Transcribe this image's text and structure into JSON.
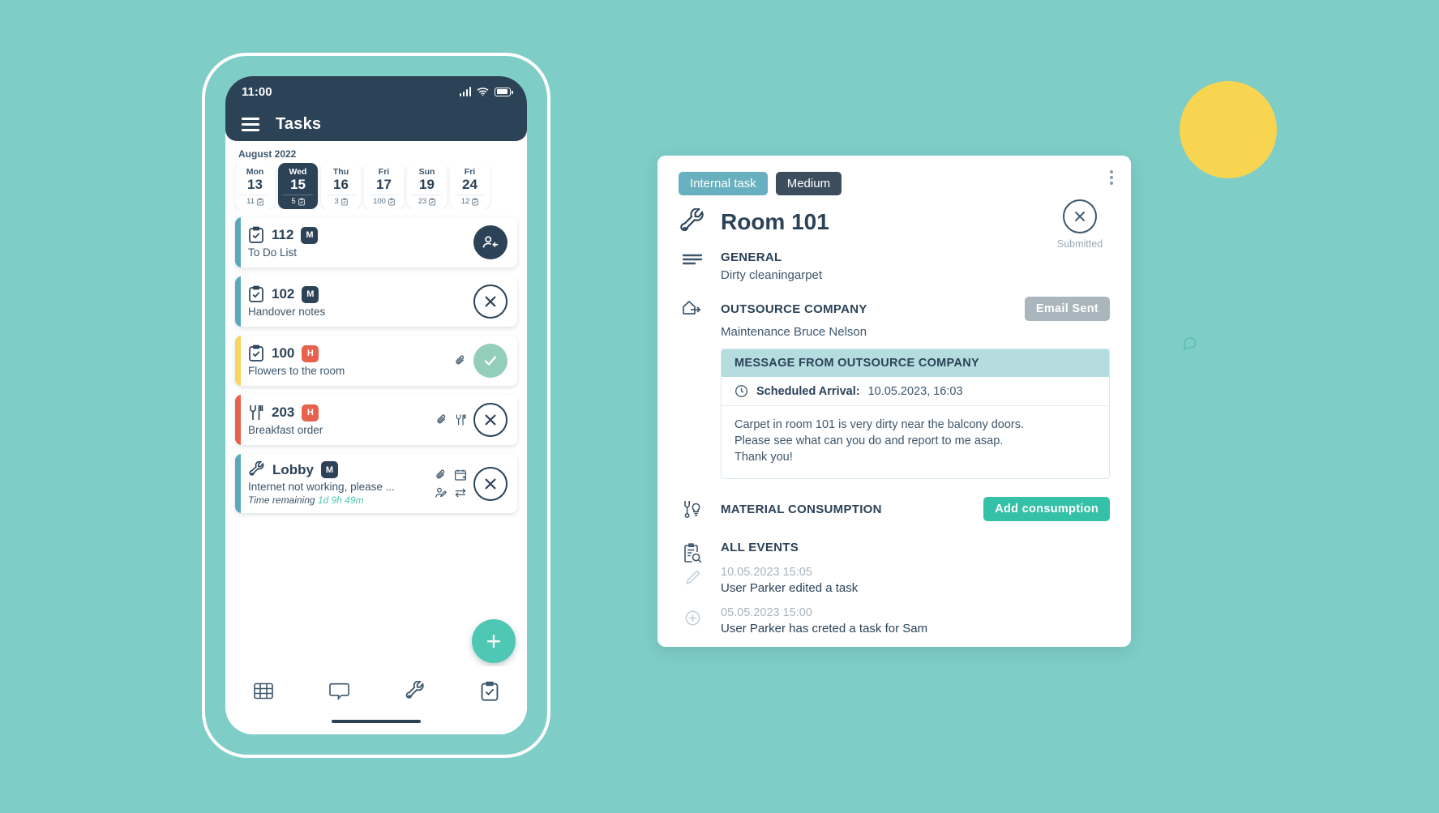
{
  "theme": {
    "background": "#7ecdc6",
    "dark": "#2b4257",
    "teal_accent": "#4ec8b4",
    "yellow": "#f8d550",
    "red": "#e8614d"
  },
  "phone": {
    "status_bar": {
      "time": "11:00",
      "signal_icon": "signal-bars-icon",
      "wifi_icon": "wifi-icon",
      "battery_icon": "battery-icon"
    },
    "app_bar": {
      "menu_icon": "hamburger-menu-icon",
      "title": "Tasks"
    },
    "calendar": {
      "month": "August 2022",
      "days": [
        {
          "dow": "Mon",
          "date": "13",
          "count": "11",
          "active": false
        },
        {
          "dow": "Wed",
          "date": "15",
          "count": "5",
          "active": true
        },
        {
          "dow": "Thu",
          "date": "16",
          "count": "3",
          "active": false
        },
        {
          "dow": "Fri",
          "date": "17",
          "count": "100",
          "active": false
        },
        {
          "dow": "Sun",
          "date": "19",
          "count": "23",
          "active": false
        },
        {
          "dow": "Fri",
          "date": "24",
          "count": "12",
          "active": false
        }
      ]
    },
    "tasks": [
      {
        "id": "112",
        "priority": "M",
        "priority_class": "prio-m",
        "bar": "bar-teal",
        "icon": "clipboard-check-icon",
        "desc": "To Do List",
        "time_label": "",
        "time_value": "",
        "meta_icons": [],
        "action": "assign-user",
        "action_class": "act-dark"
      },
      {
        "id": "102",
        "priority": "M",
        "priority_class": "prio-m",
        "bar": "bar-teal",
        "icon": "clipboard-check-icon",
        "desc": "Handover notes",
        "time_label": "",
        "time_value": "",
        "meta_icons": [],
        "action": "close",
        "action_class": "act-outline"
      },
      {
        "id": "100",
        "priority": "H",
        "priority_class": "prio-h",
        "bar": "bar-yellow",
        "icon": "clipboard-check-icon",
        "desc": "Flowers to the room",
        "time_label": "",
        "time_value": "",
        "meta_icons": [
          "attachment-icon"
        ],
        "action": "check",
        "action_class": "act-green"
      },
      {
        "id": "203",
        "priority": "H",
        "priority_class": "prio-h",
        "bar": "bar-red",
        "icon": "cutlery-icon",
        "desc": "Breakfast order",
        "time_label": "",
        "time_value": "",
        "meta_icons": [
          "attachment-icon",
          "cutlery-icon"
        ],
        "action": "close",
        "action_class": "act-outline"
      },
      {
        "id": "Lobby",
        "priority": "M",
        "priority_class": "prio-m",
        "bar": "bar-teal",
        "icon": "wrench-icon",
        "desc": "Internet not working, please ...",
        "time_label": "Time remaining",
        "time_value": "1d 9h 49m",
        "meta_icons": [
          "attachment-icon",
          "calendar-add-icon",
          "user-edit-icon",
          "transfer-icon"
        ],
        "action": "close",
        "action_class": "act-outline"
      }
    ],
    "fab": {
      "icon": "plus-icon",
      "label": "+"
    },
    "bottom_nav": [
      {
        "icon": "grid-icon",
        "name": "nav-dashboard"
      },
      {
        "icon": "chat-icon",
        "name": "nav-messages"
      },
      {
        "icon": "wrench-icon",
        "name": "nav-maintenance"
      },
      {
        "icon": "clipboard-icon",
        "name": "nav-tasks"
      }
    ]
  },
  "detail": {
    "chips": {
      "type": "Internal task",
      "priority": "Medium"
    },
    "kebab_icon": "more-vertical-icon",
    "title": "Room 101",
    "title_icon": "wrench-icon",
    "status": {
      "icon": "close-circle-icon",
      "label": "Submitted"
    },
    "general": {
      "icon": "lines-icon",
      "heading": "GENERAL",
      "text": "Dirty cleaningarpet"
    },
    "outsource": {
      "icon": "outsource-icon",
      "heading": "OUTSOURCE COMPANY",
      "text": "Maintenance Bruce Nelson",
      "button": "Email Sent"
    },
    "message": {
      "heading": "MESSAGE FROM OUTSOURCE COMPANY",
      "clock_icon": "clock-icon",
      "scheduled_label": "Scheduled Arrival:",
      "scheduled_value": "10.05.2023, 16:03",
      "line1": "Carpet in room 101 is very dirty near the balcony doors.",
      "line2": "Please see what can you do and report to me asap.",
      "line3": "Thank you!"
    },
    "material": {
      "icon": "wrench-bulb-icon",
      "heading": "MATERIAL CONSUMPTION",
      "button": "Add consumption"
    },
    "events": {
      "icon": "clipboard-search-icon",
      "heading": "ALL EVENTS",
      "items": [
        {
          "icon": "pencil-icon",
          "time": "10.05.2023 15:05",
          "text": "User Parker edited a task"
        },
        {
          "icon": "plus-circle-icon",
          "time": "05.05.2023 15:00",
          "text": "User Parker has creted a task for Sam"
        }
      ]
    }
  },
  "decor": {
    "comment_icon": "comment-bubble-icon"
  }
}
